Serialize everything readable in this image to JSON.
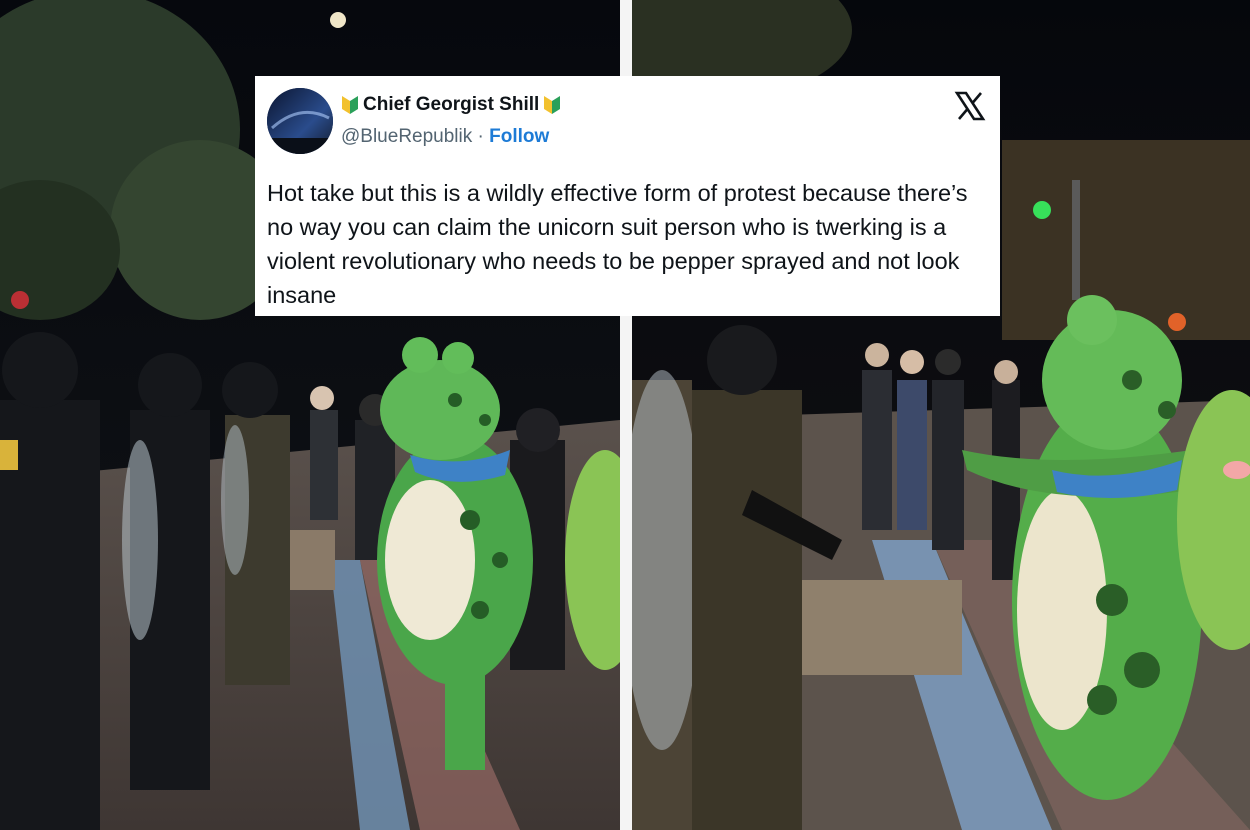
{
  "tweet": {
    "display_name": "Chief Georgist Shill",
    "handle": "@BlueRepublik",
    "separator": "·",
    "follow_label": "Follow",
    "text": "Hot take but this is a wildly effective form of protest because there’s no way you can claim the unicorn suit person who is twerking is a violent revolutionary who needs to be pepper sprayed and not look insane",
    "badge_icon": "beginner-badge-icon",
    "platform_icon": "x-logo-icon"
  },
  "photos": [
    {
      "scene": "left",
      "subject": "person in inflatable frog costume facing line of riot police at night"
    },
    {
      "scene": "right",
      "subject": "person in inflatable frog costume facing armed officers at night"
    }
  ],
  "colors": {
    "card_bg": "#ffffff",
    "follow": "#1d7bd6",
    "handle": "#536471",
    "text": "#0f1419",
    "divider": "#f4f4f4"
  }
}
